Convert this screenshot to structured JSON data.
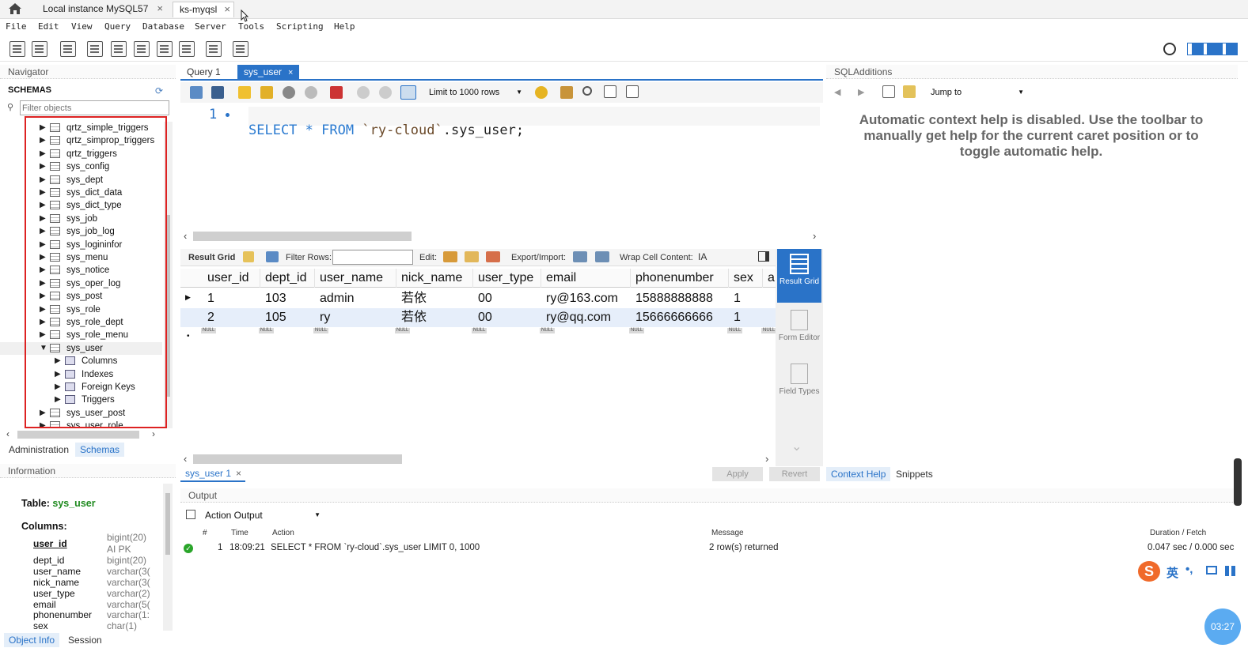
{
  "tabs": [
    {
      "label": "Local instance MySQL57"
    },
    {
      "label": "ks-myqsl"
    }
  ],
  "menu": [
    "File",
    "Edit",
    "View",
    "Query",
    "Database",
    "Server",
    "Tools",
    "Scripting",
    "Help"
  ],
  "navigator": {
    "title": "Navigator",
    "schemas_label": "SCHEMAS",
    "filter_placeholder": "Filter objects",
    "tables": [
      "qrtz_simple_triggers",
      "qrtz_simprop_triggers",
      "qrtz_triggers",
      "sys_config",
      "sys_dept",
      "sys_dict_data",
      "sys_dict_type",
      "sys_job",
      "sys_job_log",
      "sys_logininfor",
      "sys_menu",
      "sys_notice",
      "sys_oper_log",
      "sys_post",
      "sys_role",
      "sys_role_dept",
      "sys_role_menu",
      "sys_user"
    ],
    "sys_user_children": [
      "Columns",
      "Indexes",
      "Foreign Keys",
      "Triggers"
    ],
    "after_tables": [
      "sys_user_post",
      "sys_user_role"
    ],
    "bottom_tabs": [
      "Administration",
      "Schemas"
    ]
  },
  "information": {
    "title": "Information",
    "table_label": "Table:",
    "table_name": "sys_user",
    "columns_label": "Columns:",
    "columns": [
      {
        "name": "user_id",
        "type": "bigint(20)",
        "extra": "AI PK"
      },
      {
        "name": "dept_id",
        "type": "bigint(20)"
      },
      {
        "name": "user_name",
        "type": "varchar(3("
      },
      {
        "name": "nick_name",
        "type": "varchar(3("
      },
      {
        "name": "user_type",
        "type": "varchar(2)"
      },
      {
        "name": "email",
        "type": "varchar(5("
      },
      {
        "name": "phonenumber",
        "type": "varchar(1:"
      },
      {
        "name": "sex",
        "type": "char(1)"
      }
    ],
    "bottom_tabs": [
      "Object Info",
      "Session"
    ]
  },
  "editor": {
    "tabs": [
      "Query 1",
      "sys_user"
    ],
    "limit_label": "Limit to 1000 rows",
    "line_no": "1",
    "sql_keyword1": "SELECT",
    "sql_star": "*",
    "sql_keyword2": "FROM",
    "sql_schema": "`ry-cloud`",
    "sql_rest": ".sys_user;"
  },
  "results": {
    "grid_label": "Result Grid",
    "filter_label": "Filter Rows:",
    "edit_label": "Edit:",
    "export_label": "Export/Import:",
    "wrap_label": "Wrap Cell Content:",
    "columns": [
      "user_id",
      "dept_id",
      "user_name",
      "nick_name",
      "user_type",
      "email",
      "phonenumber",
      "sex",
      "a"
    ],
    "rows": [
      [
        "1",
        "103",
        "admin",
        "若依",
        "00",
        "ry@163.com",
        "15888888888",
        "1"
      ],
      [
        "2",
        "105",
        "ry",
        "若依",
        "00",
        "ry@qq.com",
        "15666666666",
        "1"
      ]
    ],
    "null_label": "NULL",
    "side_tools": [
      "Result Grid",
      "Form Editor",
      "Field Types"
    ],
    "result_tab": "sys_user 1",
    "apply": "Apply",
    "revert": "Revert"
  },
  "sqladditions": {
    "title": "SQLAdditions",
    "jump_to": "Jump to",
    "help_text": "Automatic context help is disabled. Use the toolbar to manually get help for the current caret position or to toggle automatic help.",
    "tabs": [
      "Context Help",
      "Snippets"
    ]
  },
  "output": {
    "title": "Output",
    "selector": "Action Output",
    "headers": [
      "#",
      "Time",
      "Action",
      "Message",
      "Duration / Fetch"
    ],
    "row": {
      "num": "1",
      "time": "18:09:21",
      "action": "SELECT * FROM `ry-cloud`.sys_user LIMIT 0, 1000",
      "message": "2 row(s) returned",
      "duration": "0.047 sec / 0.000 sec"
    }
  },
  "ime": {
    "label": "英"
  },
  "timer": "03:27",
  "colors": {
    "accent": "#2a73c8",
    "red_box": "#d22222",
    "success": "#2aa52a"
  }
}
